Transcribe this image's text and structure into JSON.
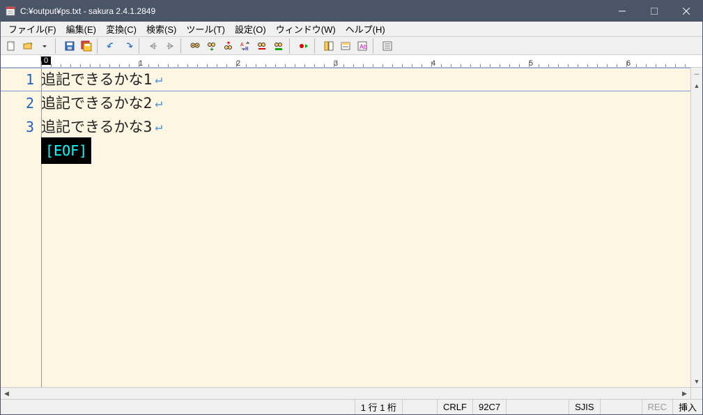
{
  "titlebar": {
    "title": "C:¥output¥ps.txt - sakura 2.4.1.2849"
  },
  "menu": {
    "items": [
      "ファイル(F)",
      "編集(E)",
      "変換(C)",
      "検索(S)",
      "ツール(T)",
      "設定(O)",
      "ウィンドウ(W)",
      "ヘルプ(H)"
    ]
  },
  "ruler": {
    "zero": "0",
    "majors": [
      "1",
      "2",
      "3",
      "4",
      "5",
      "6"
    ]
  },
  "editor": {
    "lines": [
      {
        "num": "1",
        "text": "追記できるかな1",
        "current": true
      },
      {
        "num": "2",
        "text": "追記できるかな2",
        "current": false
      },
      {
        "num": "3",
        "text": "追記できるかな3",
        "current": false
      }
    ],
    "eof": "[EOF]"
  },
  "status": {
    "pos": "1 行   1 桁",
    "eol": "CRLF",
    "code": "92C7",
    "enc": "SJIS",
    "rec": "REC",
    "ins": "挿入"
  },
  "icons": {
    "new": "new-file-icon",
    "open": "open-folder-icon",
    "save": "save-icon",
    "saveall": "save-all-icon",
    "undo": "undo-icon",
    "redo": "redo-icon",
    "back": "nav-back-icon",
    "fwd": "nav-forward-icon",
    "find": "binoculars-icon",
    "findnext": "binoculars-down-icon",
    "findprev": "binoculars-up-icon",
    "replace": "replace-icon",
    "mark": "mark-icon",
    "grep": "grep-icon",
    "rec": "record-icon",
    "outline": "outline-icon",
    "window": "window-icon",
    "typeset": "typeset-icon",
    "props": "properties-icon"
  }
}
